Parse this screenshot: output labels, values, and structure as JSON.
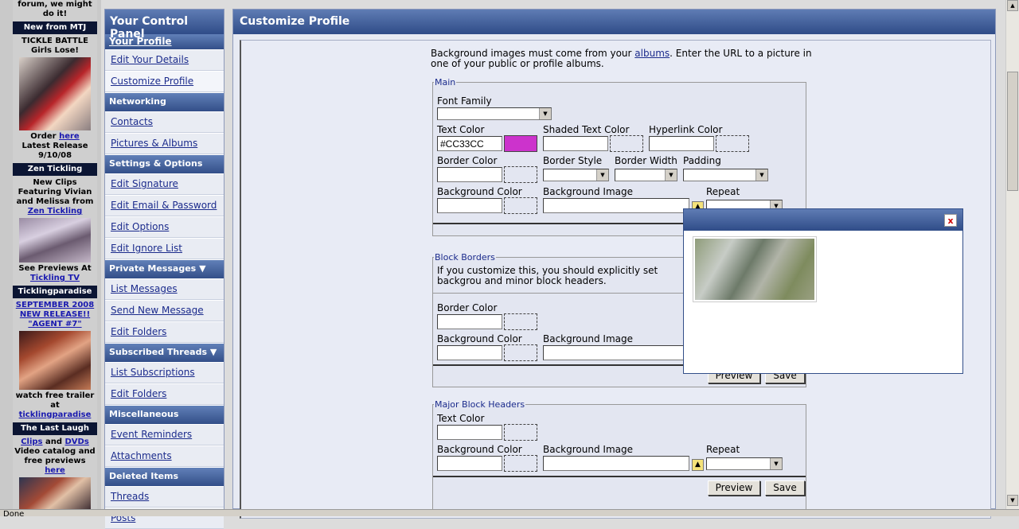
{
  "ads": {
    "top_fragment": "forum, we might do it!",
    "blocks": [
      {
        "header": "New from MTJ",
        "line1": "TICKLE BATTLE Girls Lose!",
        "order_prefix": "Order ",
        "order_link": "here",
        "release": "Latest Release 9/10/08"
      },
      {
        "header": "Zen Tickling",
        "line1": "New Clips Featuring Vivian and Melissa from",
        "link": "Zen Tickling",
        "see_prefix": "See Previews At",
        "see_link": "Tickling TV"
      },
      {
        "header": "Ticklingparadise",
        "link1": "SEPTEMBER 2008 NEW RELEASE!! \"AGENT #7\"",
        "watch": "watch free trailer at",
        "link2": "ticklingparadise"
      },
      {
        "header": "The Last Laugh",
        "clips": "Clips",
        "and": " and ",
        "dvds": "DVDs",
        "catalog": "Video catalog and free previews ",
        "here": "here"
      }
    ]
  },
  "control_panel": {
    "title": "Your Control Panel",
    "your_profile": "Your Profile",
    "edit_details": "Edit Your Details",
    "customize_profile": "Customize Profile",
    "networking": "Networking",
    "contacts": "Contacts",
    "pictures_albums": "Pictures & Albums",
    "settings_options": "Settings & Options",
    "edit_signature": "Edit Signature",
    "edit_email_password": "Edit Email & Password",
    "edit_options": "Edit Options",
    "edit_ignore_list": "Edit Ignore List",
    "private_messages": "Private Messages",
    "list_messages": "List Messages",
    "send_new_message": "Send New Message",
    "edit_folders": "Edit Folders",
    "subscribed_threads": "Subscribed Threads",
    "list_subscriptions": "List Subscriptions",
    "edit_folders_2": "Edit Folders",
    "miscellaneous": "Miscellaneous",
    "event_reminders": "Event Reminders",
    "attachments": "Attachments",
    "deleted_items": "Deleted Items",
    "threads": "Threads",
    "posts": "Posts"
  },
  "main": {
    "title": "Customize Profile",
    "intro_prefix": "Background images must come from your ",
    "intro_link": "albums",
    "intro_suffix": ". Enter the URL to a picture in one of your public or profile albums.",
    "main_group": {
      "legend": "Main",
      "font_family": "Font Family",
      "text_color": "Text Color",
      "text_color_value": "#CC33CC",
      "text_color_swatch": "#cc33cc",
      "shaded_text_color": "Shaded Text Color",
      "hyperlink_color": "Hyperlink Color",
      "border_color": "Border Color",
      "border_style": "Border Style",
      "border_width": "Border Width",
      "padding": "Padding",
      "background_color": "Background Color",
      "background_image": "Background Image",
      "repeat": "Repeat"
    },
    "block_borders": {
      "legend": "Block Borders",
      "note": "If you customize this, you should explicitly set backgrou and minor block headers.",
      "border_color": "Border Color",
      "background_color": "Background Color",
      "background_image": "Background Image",
      "preview": "Preview",
      "save": "Save"
    },
    "major_headers": {
      "legend": "Major Block Headers",
      "text_color": "Text Color",
      "background_color": "Background Color",
      "background_image": "Background Image",
      "repeat": "Repeat",
      "preview": "Preview",
      "save": "Save"
    }
  },
  "popup": {
    "close": "x"
  },
  "status": {
    "text": "Done"
  }
}
